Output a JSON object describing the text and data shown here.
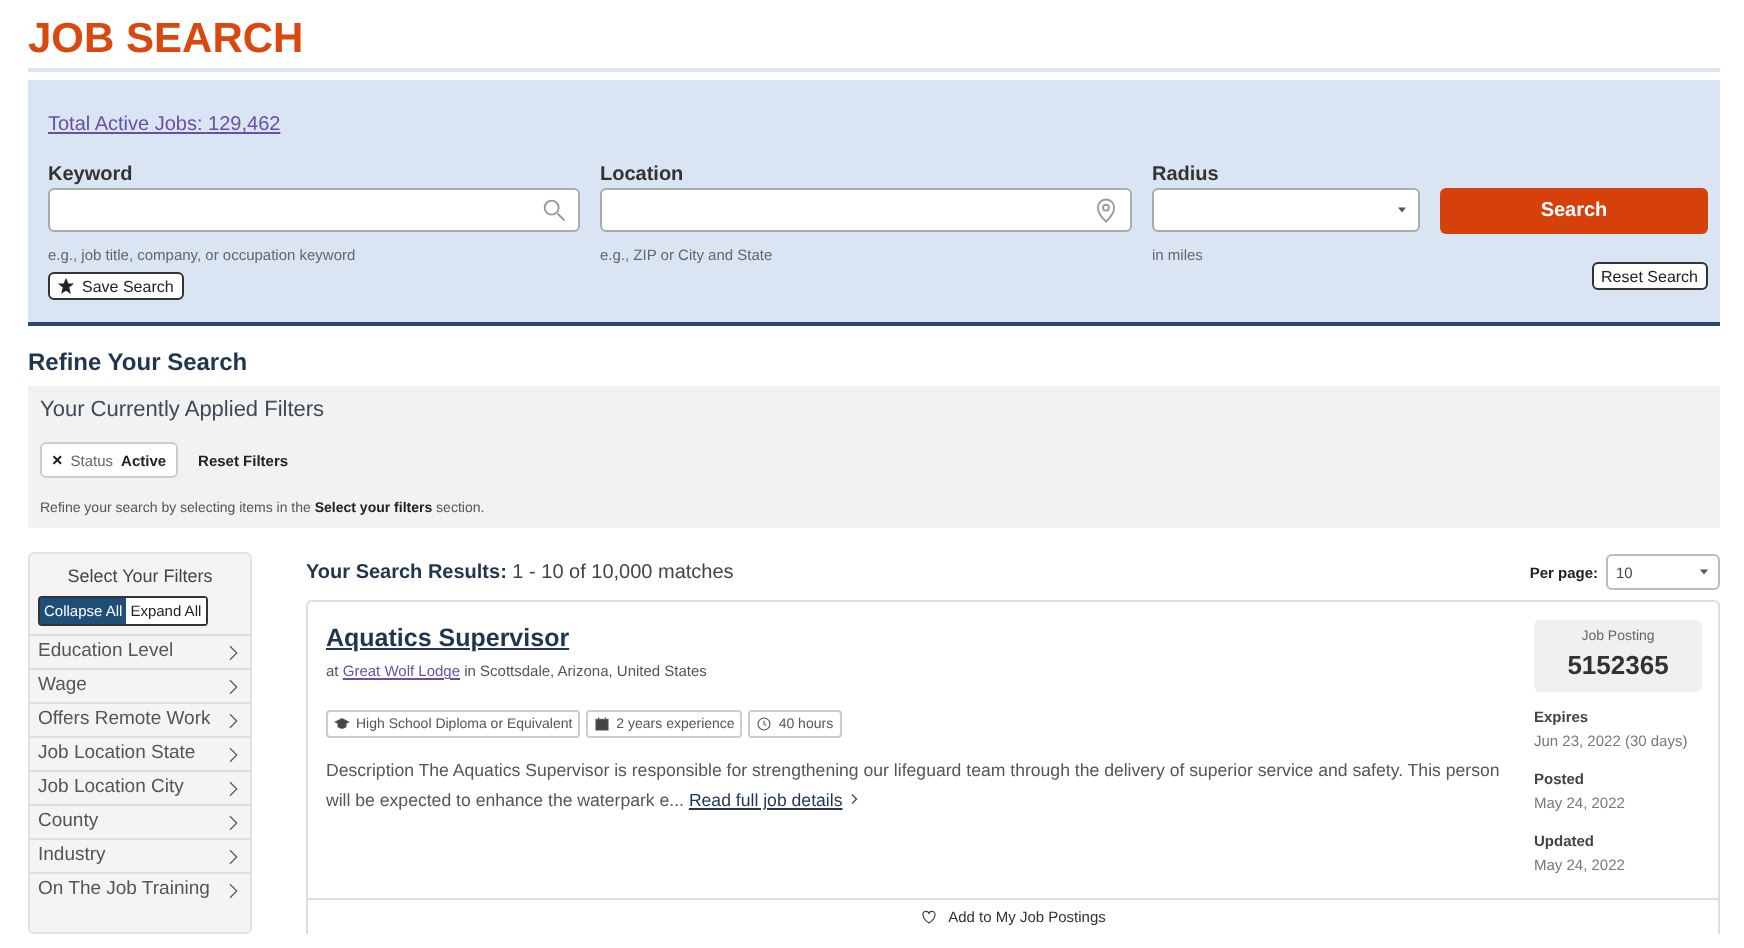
{
  "page_title": "JOB SEARCH",
  "search": {
    "total_link": "Total Active Jobs: 129,462",
    "keyword": {
      "label": "Keyword",
      "hint": "e.g., job title, company, or occupation keyword"
    },
    "location": {
      "label": "Location",
      "hint": "e.g., ZIP or City and State"
    },
    "radius": {
      "label": "Radius",
      "hint": "in miles"
    },
    "search_button": "Search",
    "save_button": "Save Search",
    "reset_button": "Reset Search"
  },
  "refine": {
    "heading": "Refine Your Search",
    "applied_heading": "Your Currently Applied Filters",
    "chips": [
      {
        "remove": "×",
        "label": "Status",
        "value": "Active"
      }
    ],
    "reset_filters": "Reset Filters",
    "note": "Refine your search by selecting items in the **Select your filters** section."
  },
  "sidebar": {
    "title": "Select Your Filters",
    "toggles": [
      {
        "label": "Collapse All",
        "selected": true
      },
      {
        "label": "Expand All",
        "selected": false
      }
    ],
    "items": [
      {
        "label": "Education Level"
      },
      {
        "label": "Wage"
      },
      {
        "label": "Offers Remote Work"
      },
      {
        "label": "Job Location State"
      },
      {
        "label": "Job Location City"
      },
      {
        "label": "County"
      },
      {
        "label": "Industry"
      },
      {
        "label": "On The Job Training"
      }
    ]
  },
  "results": {
    "summary": "**Your Search Results:** 1 - 10 of 10,000 matches",
    "per_page_label": "Per page:",
    "per_page_value": "10",
    "jobs": [
      {
        "title": "Aquatics Supervisor",
        "at": "at",
        "company": "Great Wolf Lodge",
        "location": "in Scottsdale, Arizona, United States",
        "tags": [
          {
            "kind": "education",
            "label": "High School Diploma or Equivalent"
          },
          {
            "kind": "experience",
            "label": "2 years experience"
          },
          {
            "kind": "hours",
            "label": "40 hours"
          }
        ],
        "description": "Description The Aquatics Supervisor is responsible for strengthening our lifeguard team through the delivery of superior service and safety. This person will be expected to enhance the waterpark e...",
        "details_link": "Read full job details",
        "posting_label": "Job Posting",
        "posting_number": "5152365",
        "meta": [
          {
            "label": "Expires",
            "value": "Jun 23, 2022 (30 days)"
          },
          {
            "label": "Posted",
            "value": "May 24, 2022"
          },
          {
            "label": "Updated",
            "value": "May 24, 2022"
          }
        ],
        "save_action": "Add to My Job Postings"
      }
    ]
  }
}
